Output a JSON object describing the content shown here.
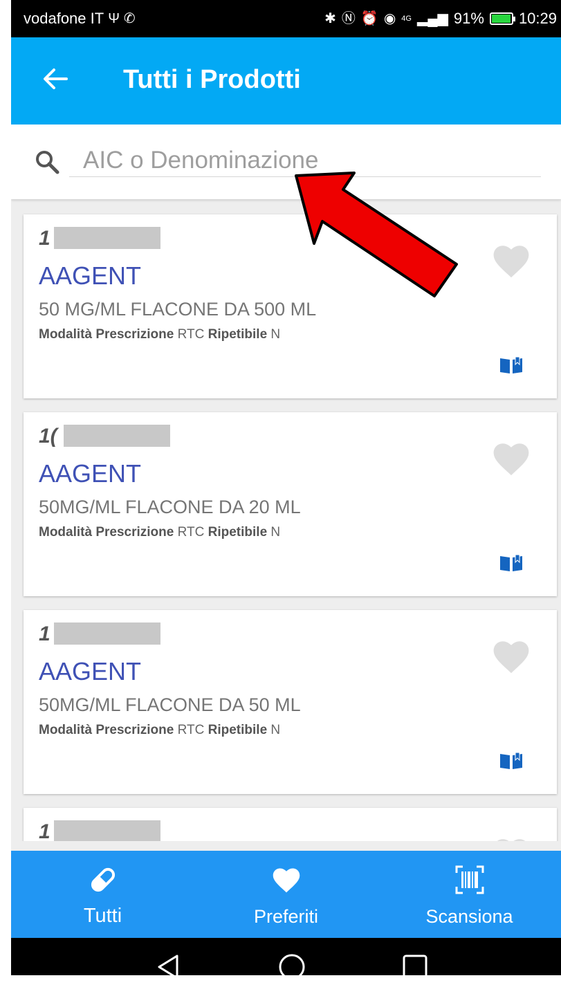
{
  "status_bar": {
    "carrier": "vodafone IT",
    "network": "4G",
    "battery": "91%",
    "battery_level": 0.91,
    "time": "10:29"
  },
  "app_bar": {
    "title": "Tutti i Prodotti",
    "back_icon": "arrow-left-icon"
  },
  "search": {
    "placeholder": "AIC o Denominazione",
    "value": "",
    "icon": "search-icon"
  },
  "products": [
    {
      "code": "1",
      "name": "AAGENT",
      "description": "50 MG/ML FLACONE DA 500 ML",
      "prescription_label": "Modalità Prescrizione",
      "prescription_value": "RTC",
      "repeatable_label": "Ripetibile",
      "repeatable_value": "N"
    },
    {
      "code": "1(",
      "name": "AAGENT",
      "description": "50MG/ML FLACONE DA 20 ML",
      "prescription_label": "Modalità Prescrizione",
      "prescription_value": "RTC",
      "repeatable_label": "Ripetibile",
      "repeatable_value": "N"
    },
    {
      "code": "1",
      "name": "AAGENT",
      "description": "50MG/ML FLACONE DA 50 ML",
      "prescription_label": "Modalità Prescrizione",
      "prescription_value": "RTC",
      "repeatable_label": "Ripetibile",
      "repeatable_value": "N"
    },
    {
      "code": "1"
    }
  ],
  "bottom_nav": {
    "items": [
      {
        "label": "Tutti",
        "icon": "pill-icon"
      },
      {
        "label": "Preferiti",
        "icon": "heart-icon"
      },
      {
        "label": "Scansiona",
        "icon": "barcode-scan-icon"
      }
    ],
    "active": "Tutti"
  },
  "colors": {
    "app_bar": "#03a9f4",
    "bottom_nav": "#2196f3",
    "product_name": "#3f51b5",
    "heart_inactive": "#dddddd",
    "arrow_annotation": "#ee0000"
  }
}
